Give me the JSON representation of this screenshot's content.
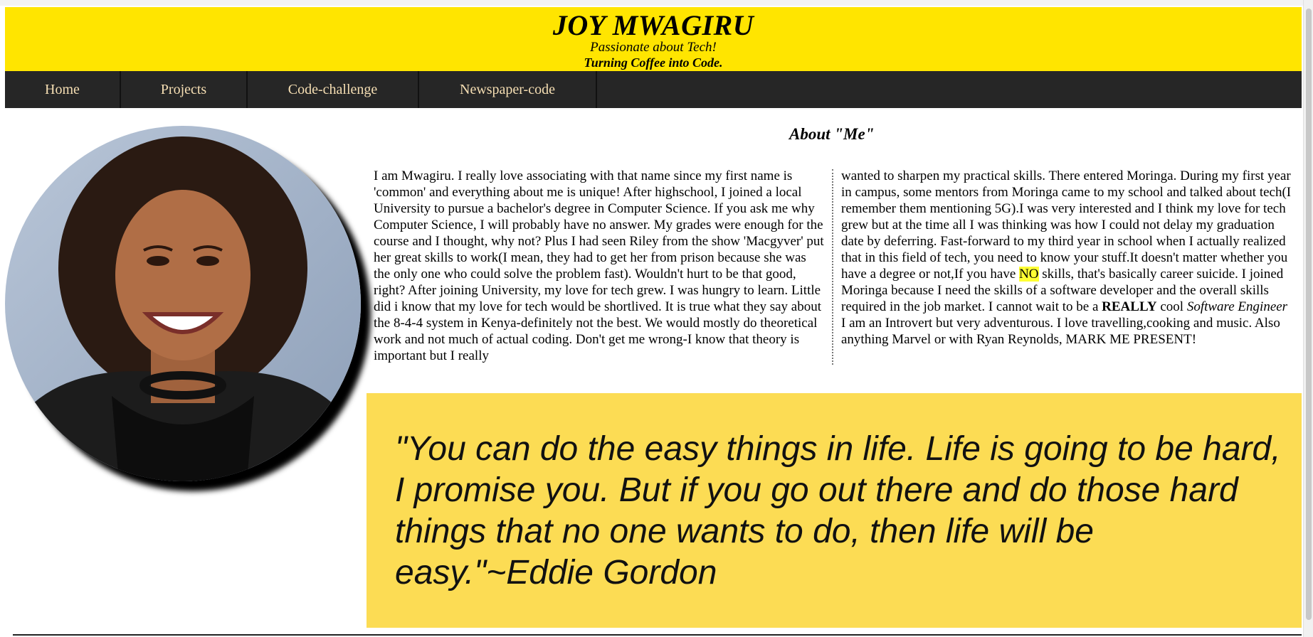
{
  "header": {
    "name": "JOY MWAGIRU",
    "tagline1": "Passionate about Tech!",
    "tagline2": "Turning Coffee into Code."
  },
  "nav": [
    "Home",
    "Projects",
    "Code-challenge",
    "Newspaper-code"
  ],
  "about": {
    "title": "About \"Me\"",
    "col1": "I am Mwagiru. I really love associating with that name since my first name is 'common' and everything about me is unique! After highschool, I joined a local University to pursue a bachelor's degree in Computer Science. If you ask me why Computer Science, I will probably have no answer. My grades were enough for the course and I thought, why not? Plus I had seen Riley from the show 'Macgyver' put her great skills to work(I mean, they had to get her from prison because she was the only one who could solve the problem fast). Wouldn't hurt to be that good, right? After joining University, my love for tech grew. I was hungry to learn. Little did i know that my love for tech would be shortlived. It is true what they say about the 8-4-4 system in Kenya-definitely not the best. We would mostly do theoretical work and not much of actual coding. Don't get me wrong-I know that theory is important but I really",
    "col2_part1": "wanted to sharpen my practical skills. There entered Moringa. During my first year in campus, some mentors from Moringa came to my school and talked about tech(I remember them mentioning 5G).I was very interested and I think my love for tech grew but at the time all I was thinking was how I could not delay my graduation date by deferring. Fast-forward to my third year in school when I actually realized that in this field of tech, you need to know your stuff.It doesn't matter whether you have a degree or not,If you have ",
    "col2_highlight": "NO",
    "col2_part2": " skills, that's basically career suicide. I joined Moringa because I need the skills of a software developer and the overall skills required in the job market. I cannot wait to be a ",
    "col2_bold": "REALLY",
    "col2_part3": " cool ",
    "col2_italic": "Software Engineer",
    "col2_part4": "I am an Introvert but very adventurous. I love travelling,cooking and music. Also anything Marvel or with Ryan Reynolds, MARK ME PRESENT!"
  },
  "quote": "\"You can do the easy things in life. Life is going to be hard, I promise you. But if you go out there and do those hard things that no one wants to do, then life will be easy.\"~Eddie Gordon",
  "colors": {
    "header_bg": "#ffe500",
    "nav_bg": "#262626",
    "nav_text": "#f5deb3",
    "quote_bg": "#fcdc54",
    "highlight": "#ffff33"
  }
}
